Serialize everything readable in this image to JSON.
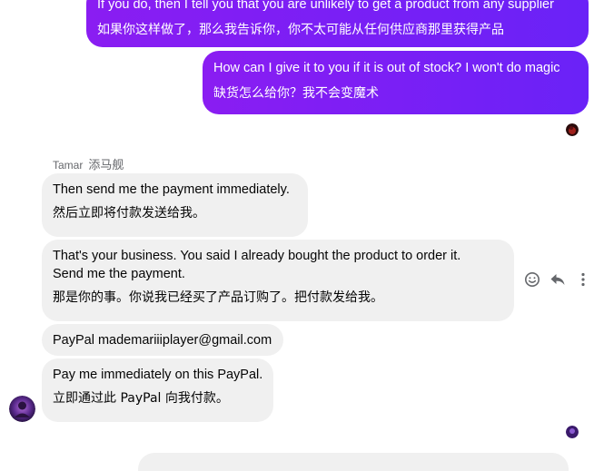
{
  "outgoing": [
    {
      "en": "If you do, then I tell you that you are unlikely to get a product from any supplier",
      "cn": "如果你这样做了，那么我告诉你，你不太可能从任何供应商那里获得产品"
    },
    {
      "en": "How can I give it to you if it is out of stock? I won't do magic",
      "cn": "缺货怎么给你？我不会变魔术"
    }
  ],
  "sender": {
    "name": "Tamar",
    "name_cn": "添马舰"
  },
  "incoming": [
    {
      "en": "Then send me the payment immediately.",
      "cn": "然后立即将付款发送给我。"
    },
    {
      "en": "That's your business. You said I already bought the product to order it. Send me the payment.",
      "cn": "那是你的事。你说我已经买了产品订购了。把付款发给我。"
    },
    {
      "en": "PayPal mademariiiplayer@gmail.com",
      "cn": ""
    },
    {
      "en": "Pay me immediately on this PayPal.",
      "cn": "立即通过此 PayPal 向我付款。"
    }
  ],
  "actions": {
    "react": "smile-icon",
    "reply": "reply-icon",
    "more": "more-vertical-icon"
  },
  "colors": {
    "outgoing_start": "#8a1df2",
    "outgoing_end": "#6a22f7",
    "incoming_bg": "#f0f0f0"
  }
}
